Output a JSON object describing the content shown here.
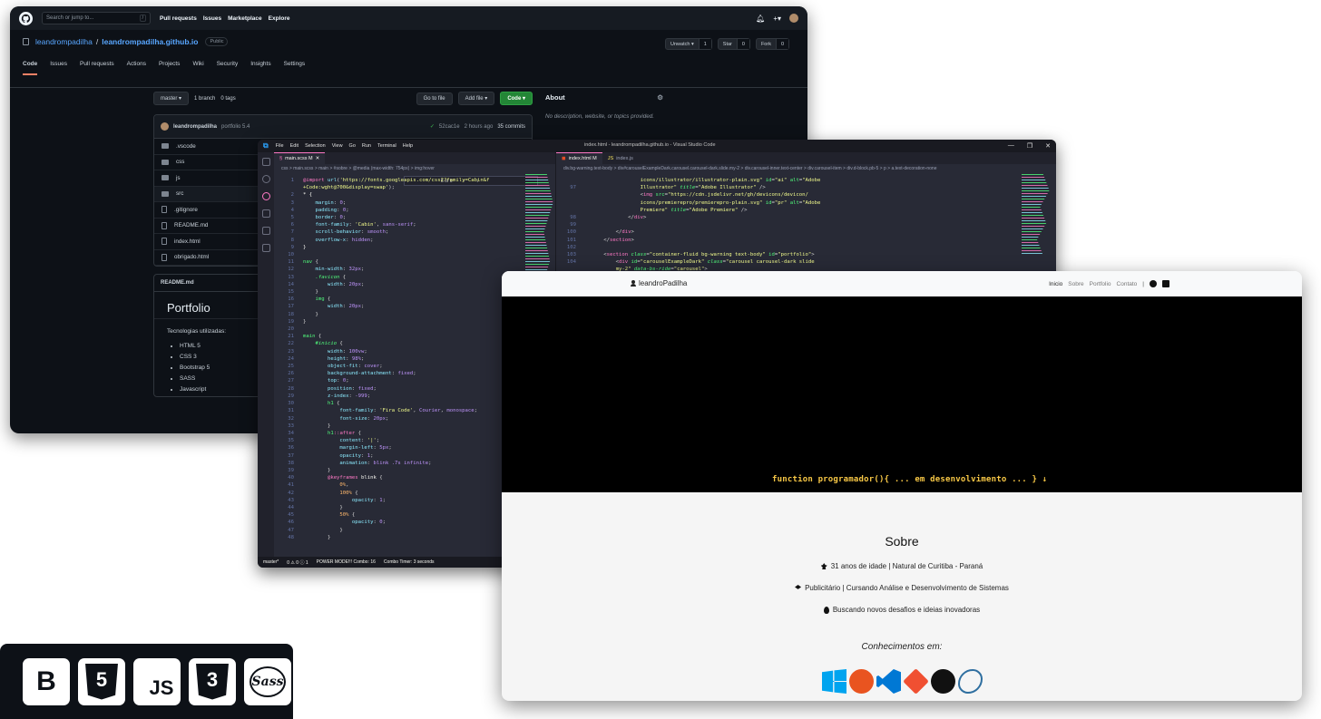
{
  "github": {
    "search_placeholder": "Search or jump to...",
    "search_key": "/",
    "nav": [
      "Pull requests",
      "Issues",
      "Marketplace",
      "Explore"
    ],
    "repo": {
      "owner": "leandrompadilha",
      "separator": "/",
      "name": "leandrompadilha.github.io",
      "visibility": "Public"
    },
    "actions": {
      "watch": "Unwatch ▾",
      "watch_count": "1",
      "star": "Star",
      "star_count": "0",
      "fork": "Fork",
      "fork_count": "0"
    },
    "tabs": [
      "Code",
      "Issues",
      "Pull requests",
      "Actions",
      "Projects",
      "Wiki",
      "Security",
      "Insights",
      "Settings"
    ],
    "branch": "master ▾",
    "branch_count": "1 branch",
    "tag_count": "0 tags",
    "buttons": {
      "goto_file": "Go to file",
      "add_file": "Add file ▾",
      "code": "Code ▾"
    },
    "commit": {
      "author": "leandrompadilha",
      "message": "portfolio 5.4",
      "hash": "52cac1e",
      "time": "2 hours ago",
      "count": "35 commits"
    },
    "files": [
      ".vscode",
      "css",
      "js",
      "src",
      ".gitignore",
      "README.md",
      "index.html",
      "obrigado.html"
    ],
    "readme": {
      "label": "README.md",
      "title": "Portfolio",
      "subtitle": "Tecnologias utilizadas:",
      "items": [
        "HTML 5",
        "CSS 3",
        "Bootstrap 5",
        "SASS",
        "Javascript"
      ]
    },
    "about": {
      "title": "About",
      "text": "No description, website, or topics provided."
    }
  },
  "vscode": {
    "menus": [
      "File",
      "Edit",
      "Selection",
      "View",
      "Go",
      "Run",
      "Terminal",
      "Help"
    ],
    "title": "index.html - leandrompadilha.github.io - Visual Studio Code",
    "tab_left": "main.scss M",
    "tab_right_active": "index.html M",
    "tab_right_other": "index.js",
    "breadcrumb_left": "css > main.scss > main > #sobre > @media (max-width: 754px) > img:hover",
    "breadcrumb_right": "div.bg-warning.text-body > div#carouselExampleDark.carousel.carousel-dark.slide.my-2 > div.carousel-inner.text-center > div.carousel-item > div.d-block.pb-5 > p > a.text-decoration-none",
    "find_result": "5 of 6",
    "status": {
      "branch": "master*",
      "errors": "0 ⚠ 0 ⓘ 1",
      "power": "POWER MODE!!! Combo: 16",
      "timer": "Combo Timer: 3 seconds"
    }
  },
  "site": {
    "brand": "leandroPadilha",
    "links": [
      "Inicio",
      "Sobre",
      "Portfolio",
      "Contato",
      "|"
    ],
    "hero_text": "function programador(){ ... em desenvolvimento ... } ↓",
    "sobre_title": "Sobre",
    "lines": [
      "31 anos de idade | Natural de Curitiba - Paraná",
      "Publicitário | Cursando Análise e Desenvolvimento de Sistemas",
      "Buscando novos desafios e ideias inovadoras"
    ],
    "knowledge_title": "Conhecimentos em:",
    "tech_icons": [
      "windows-icon",
      "ubuntu-icon",
      "vscode-icon",
      "git-icon",
      "github-icon",
      "mysql-icon"
    ]
  },
  "badges": {
    "bootstrap": "B",
    "html": "5",
    "js": "JS",
    "css": "3",
    "sass": "Sass"
  }
}
